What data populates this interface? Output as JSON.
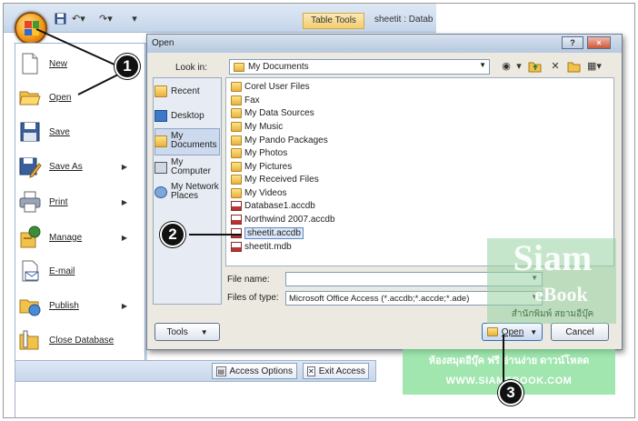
{
  "access_window": {
    "title": "sheetit : Datab",
    "contextual_tab": "Table Tools"
  },
  "office_menu": {
    "items": [
      {
        "label": "New",
        "icon": "new-document-icon",
        "has_submenu": false
      },
      {
        "label": "Open",
        "icon": "open-folder-icon",
        "has_submenu": false
      },
      {
        "label": "Save",
        "icon": "save-disk-icon",
        "has_submenu": false
      },
      {
        "label": "Save As",
        "icon": "save-as-icon",
        "has_submenu": true
      },
      {
        "label": "Print",
        "icon": "printer-icon",
        "has_submenu": true
      },
      {
        "label": "Manage",
        "icon": "manage-icon",
        "has_submenu": true
      },
      {
        "label": "E-mail",
        "icon": "email-icon",
        "has_submenu": false
      },
      {
        "label": "Publish",
        "icon": "publish-icon",
        "has_submenu": true
      },
      {
        "label": "Close Database",
        "icon": "close-database-icon",
        "has_submenu": false
      }
    ],
    "access_options": "Access Options",
    "exit_access": "Exit Access"
  },
  "open_dialog": {
    "title": "Open",
    "help_btn": "?",
    "close_btn": "×",
    "look_in_label": "Look in:",
    "look_in_value": "My Documents",
    "places": [
      {
        "label": "Recent",
        "icon": "recent-icon"
      },
      {
        "label": "Desktop",
        "icon": "desktop-icon"
      },
      {
        "label": "My Documents",
        "icon": "my-documents-icon"
      },
      {
        "label": "My Computer",
        "icon": "my-computer-icon"
      },
      {
        "label": "My Network Places",
        "icon": "network-places-icon"
      }
    ],
    "files": [
      {
        "name": "Corel User Files",
        "type": "folder"
      },
      {
        "name": "Fax",
        "type": "folder"
      },
      {
        "name": "My Data Sources",
        "type": "folder"
      },
      {
        "name": "My Music",
        "type": "folder"
      },
      {
        "name": "My Pando Packages",
        "type": "folder"
      },
      {
        "name": "My Photos",
        "type": "folder"
      },
      {
        "name": "My Pictures",
        "type": "folder"
      },
      {
        "name": "My Received Files",
        "type": "folder"
      },
      {
        "name": "My Videos",
        "type": "folder"
      },
      {
        "name": "Database1.accdb",
        "type": "database"
      },
      {
        "name": "Northwind 2007.accdb",
        "type": "database"
      },
      {
        "name": "sheetit.accdb",
        "type": "database",
        "selected": true
      },
      {
        "name": "sheetit.mdb",
        "type": "database"
      }
    ],
    "file_name_label": "File name:",
    "file_name_value": "",
    "files_of_type_label": "Files of type:",
    "files_of_type_value": "Microsoft Office Access (*.accdb;*.accde;*.ade)",
    "tools_btn": "Tools",
    "open_btn": "Open",
    "cancel_btn": "Cancel"
  },
  "callouts": [
    "1",
    "2",
    "3"
  ],
  "watermark": {
    "title": "Siam",
    "subtitle": "eBook",
    "thai": "สำนักพิมพ์ สยามอีบุ๊ค",
    "thai2": "ห้องสมุดอีบุ๊ค ฟรี อ่านง่าย ดาวน์โหลด",
    "url": "WWW.SIAMEBOOK.COM"
  }
}
